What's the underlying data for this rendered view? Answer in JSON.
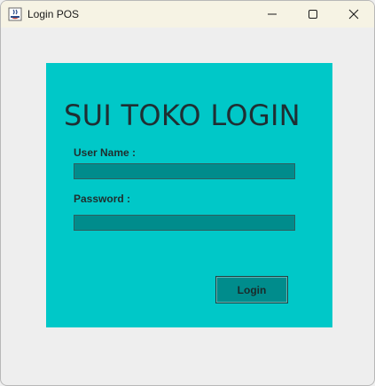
{
  "window": {
    "title": "Login POS",
    "icon": "java-app-icon",
    "controls": [
      "minimize-icon",
      "maximize-icon",
      "close-icon"
    ]
  },
  "login_panel": {
    "heading": "SUI TOKO LOGIN",
    "username_label": "User Name :",
    "username_value": "",
    "password_label": "Password :",
    "password_value": "",
    "login_button_label": "Login"
  },
  "colors": {
    "panel_background": "#00c8c8",
    "field_background": "#008c8c",
    "window_background": "#eeeeee",
    "titlebar_background": "#f6f3e4"
  }
}
